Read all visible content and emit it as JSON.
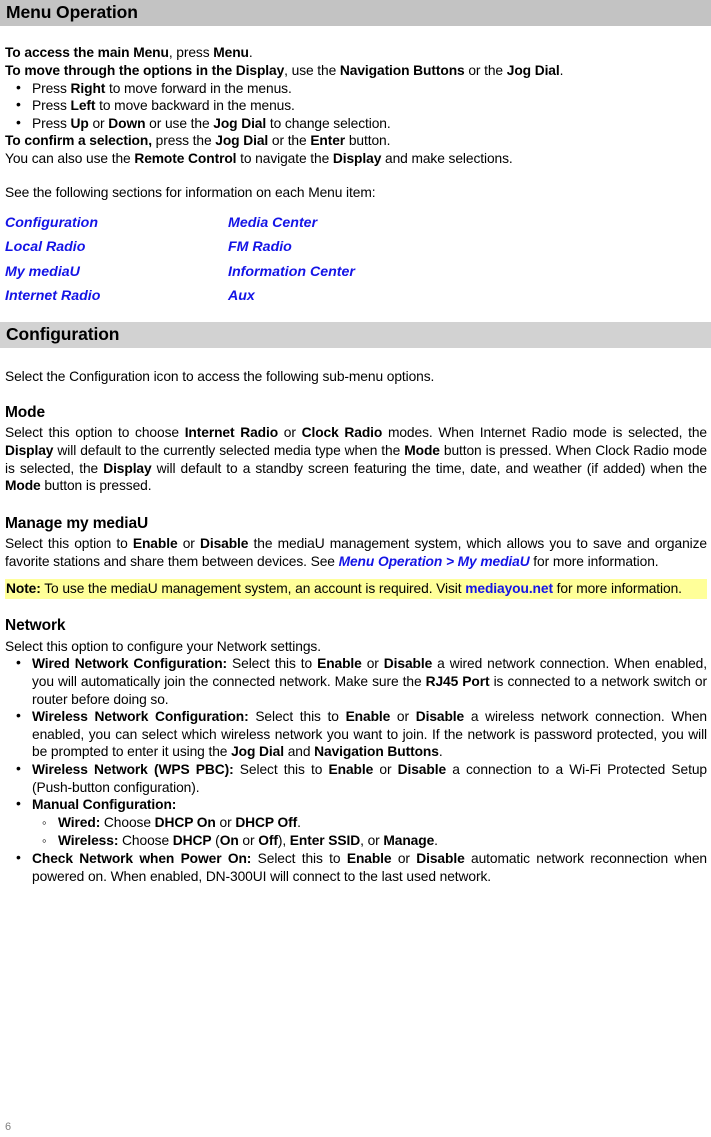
{
  "page": {
    "number": "6"
  },
  "headings": {
    "menu_operation": "Menu Operation",
    "configuration": "Configuration",
    "mode": "Mode",
    "manage_my_mediau": "Manage my mediaU",
    "network": "Network"
  },
  "intro": {
    "line1_bold": "To access the main Menu",
    "line1_mid": ", press ",
    "line1_bold2": "Menu",
    "line1_end": ".",
    "line2_bold": "To move through the options in the Display",
    "line2_mid": ", use the ",
    "line2_bold2": "Navigation Buttons",
    "line2_mid2": " or the ",
    "line2_bold3": "Jog Dial",
    "line2_end": ".",
    "bullets": [
      {
        "pre": "Press ",
        "key": "Right",
        "post": " to move forward in the menus."
      },
      {
        "pre": "Press ",
        "key": "Left",
        "post": " to move backward in the menus."
      },
      {
        "pre": "Press ",
        "key": "Up",
        "mid": " or ",
        "key2": "Down",
        "mid2": " or use the ",
        "key3": "Jog Dial",
        "post": " to change selection."
      }
    ],
    "confirm_bold": "To confirm a selection,",
    "confirm_mid": " press the ",
    "confirm_bold2": "Jog Dial",
    "confirm_mid2": " or the ",
    "confirm_bold3": "Enter",
    "confirm_end": " button.",
    "remote_pre": "You can also use the ",
    "remote_bold": "Remote Control",
    "remote_mid": " to navigate the ",
    "remote_bold2": "Display",
    "remote_end": " and make selections.",
    "see_sections": "See the following sections for information on each Menu item:"
  },
  "menu_items": {
    "column1": [
      "Configuration",
      "Local Radio",
      "My mediaU",
      "Internet Radio"
    ],
    "column2": [
      "Media Center",
      "FM Radio",
      "Information Center",
      "Aux"
    ]
  },
  "configuration": {
    "intro": "Select the Configuration icon to access the following sub-menu options.",
    "mode": {
      "p1": "Select this option to choose ",
      "b1": "Internet Radio",
      "p2": " or ",
      "b2": "Clock Radio",
      "p3": " modes. When Internet Radio mode is selected, the ",
      "b3": "Display",
      "p4": " will default to the currently selected media type when the ",
      "b4": "Mode",
      "p5": " button is pressed. When Clock Radio mode is selected, the ",
      "b5": "Display",
      "p6": " will default to a standby screen featuring the time, date, and weather (if added) when the ",
      "b6": "Mode",
      "p7": " button is pressed."
    },
    "mediau": {
      "p1": "Select this option to ",
      "b1": "Enable",
      "p2": " or ",
      "b2": "Disable",
      "p3": " the mediaU management system, which allows you to save and organize favorite stations and share them between devices. See ",
      "link1": "Menu Operation > My mediaU",
      "p4": " for more information.",
      "note_label": "Note:",
      "note_text1": " To use the mediaU management system, an account is required. Visit ",
      "note_link": "mediayou.net",
      "note_text2": " for more information."
    },
    "network": {
      "intro": "Select this option to configure your Network settings.",
      "bullets": [
        {
          "label": "Wired Network Configuration:",
          "t1": " Select this to ",
          "b1": "Enable",
          "t2": " or ",
          "b2": "Disable",
          "t3": " a wired network connection. When enabled, you will automatically join the connected network. Make sure the ",
          "b3": "RJ45 Port",
          "t4": " is connected to a network switch or router before doing so."
        },
        {
          "label": "Wireless Network Configuration:",
          "t1": " Select this to ",
          "b1": "Enable",
          "t2": " or ",
          "b2": "Disable",
          "t3": " a wireless network connection. When enabled, you can select which wireless network you want to join. If the network is password protected, you will be prompted to enter it using the ",
          "b3": "Jog Dial",
          "t4": " and ",
          "b4": "Navigation Buttons",
          "t5": "."
        },
        {
          "label": "Wireless Network (WPS PBC):",
          "t1": " Select this to ",
          "b1": "Enable",
          "t2": " or ",
          "b2": "Disable",
          "t3": " a connection to a Wi-Fi Protected Setup (Push-button configuration)."
        }
      ],
      "manual_label": "Manual Configuration:",
      "manual_sub": [
        {
          "label": "Wired:",
          "t1": " Choose ",
          "b1": "DHCP On",
          "t2": " or ",
          "b2": "DHCP Off",
          "t3": "."
        },
        {
          "label": "Wireless:",
          "t1": " Choose ",
          "b1": "DHCP",
          "t2": " (",
          "b2": "On",
          "t3": " or ",
          "b3": "Off",
          "t4": "), ",
          "b4": "Enter SSID",
          "t5": ", or ",
          "b5": "Manage",
          "t6": "."
        }
      ],
      "power_on": {
        "label": "Check Network when Power On:",
        "t1": " Select this to ",
        "b1": "Enable",
        "t2": " or ",
        "b2": "Disable",
        "t3": " automatic network reconnection when powered on. When enabled, DN-300UI will connect to the last used network."
      }
    }
  },
  "colors": {
    "band_main": "#c3c3c3",
    "band_sub": "#d2d2d2",
    "link": "#1414e6",
    "note_highlight": "#ffff99",
    "page_number": "#7f7f7f"
  }
}
